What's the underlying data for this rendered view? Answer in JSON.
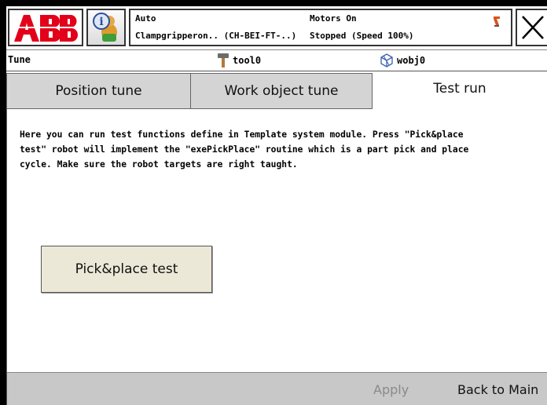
{
  "header": {
    "logo_text": "ABB",
    "mode": "Auto",
    "system": "Clampgripperon.. (CH-BEI-FT-..)",
    "motors": "Motors On",
    "state": "Stopped (Speed 100%)"
  },
  "titlebar": {
    "title": "Tune",
    "tool": "tool0",
    "workobject": "wobj0"
  },
  "tabs": [
    {
      "label": "Position tune",
      "active": false
    },
    {
      "label": "Work object  tune",
      "active": false
    },
    {
      "label": "Test run",
      "active": true
    }
  ],
  "content": {
    "description_lines": [
      "Here you can run test functions define in Template system module. Press \"Pick&place",
      "test\" robot will implement the \"exePickPlace\" routine which is a part pick and place",
      "cycle. Make sure the robot targets are right taught."
    ],
    "pick_button_label": "Pick&place test"
  },
  "footer": {
    "apply_label": "Apply",
    "back_label": "Back to Main"
  },
  "colors": {
    "abb_red": "#e3001b",
    "tab_inactive": "#d4d4d4",
    "button_face": "#ece8d8",
    "footer_bg": "#c8c8c8",
    "disabled_text": "#8a8a8a"
  }
}
